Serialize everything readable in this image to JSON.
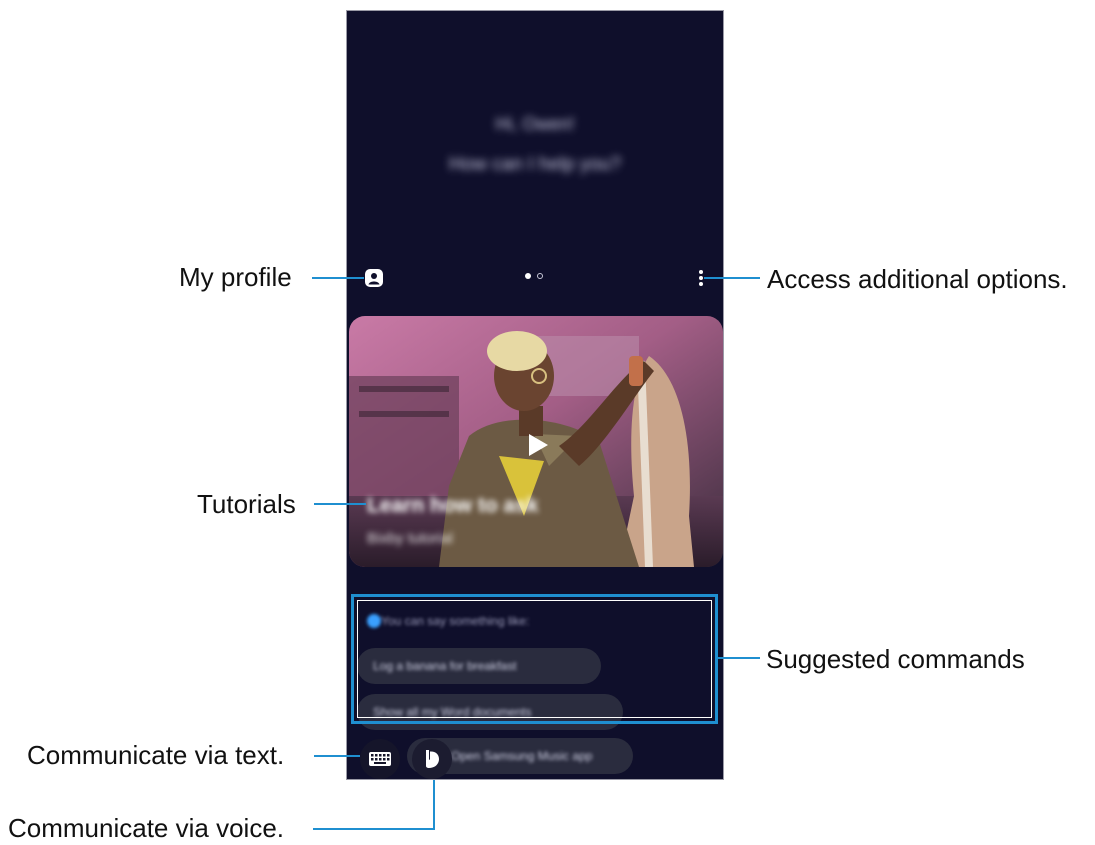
{
  "callouts": {
    "my_profile": "My profile",
    "more_options": "Access additional options.",
    "tutorials": "Tutorials",
    "suggested_commands": "Suggested commands",
    "via_text": "Communicate via text.",
    "via_voice": "Communicate via voice."
  },
  "screen": {
    "greeting_line1": "Hi, Owen!",
    "greeting_line2": "How can I help you?",
    "page_indicator": {
      "pages": 2,
      "current": 1
    },
    "tutorial": {
      "title": "Learn how to ask",
      "subtitle": "Bixby tutorial"
    },
    "suggestions": {
      "header": "You can say something like:",
      "commands": [
        "Log a banana for breakfast",
        "Show all my Word documents",
        "Open Samsung Music app"
      ]
    }
  },
  "icons": {
    "profile": "profile-icon",
    "more": "more-options-icon",
    "play": "play-icon",
    "keyboard": "keyboard-icon",
    "bixby": "bixby-voice-icon"
  },
  "colors": {
    "screen_bg": "#0f0f2b",
    "callout_line": "#1f8fd0",
    "chip_bg": "#2a2c3e"
  }
}
